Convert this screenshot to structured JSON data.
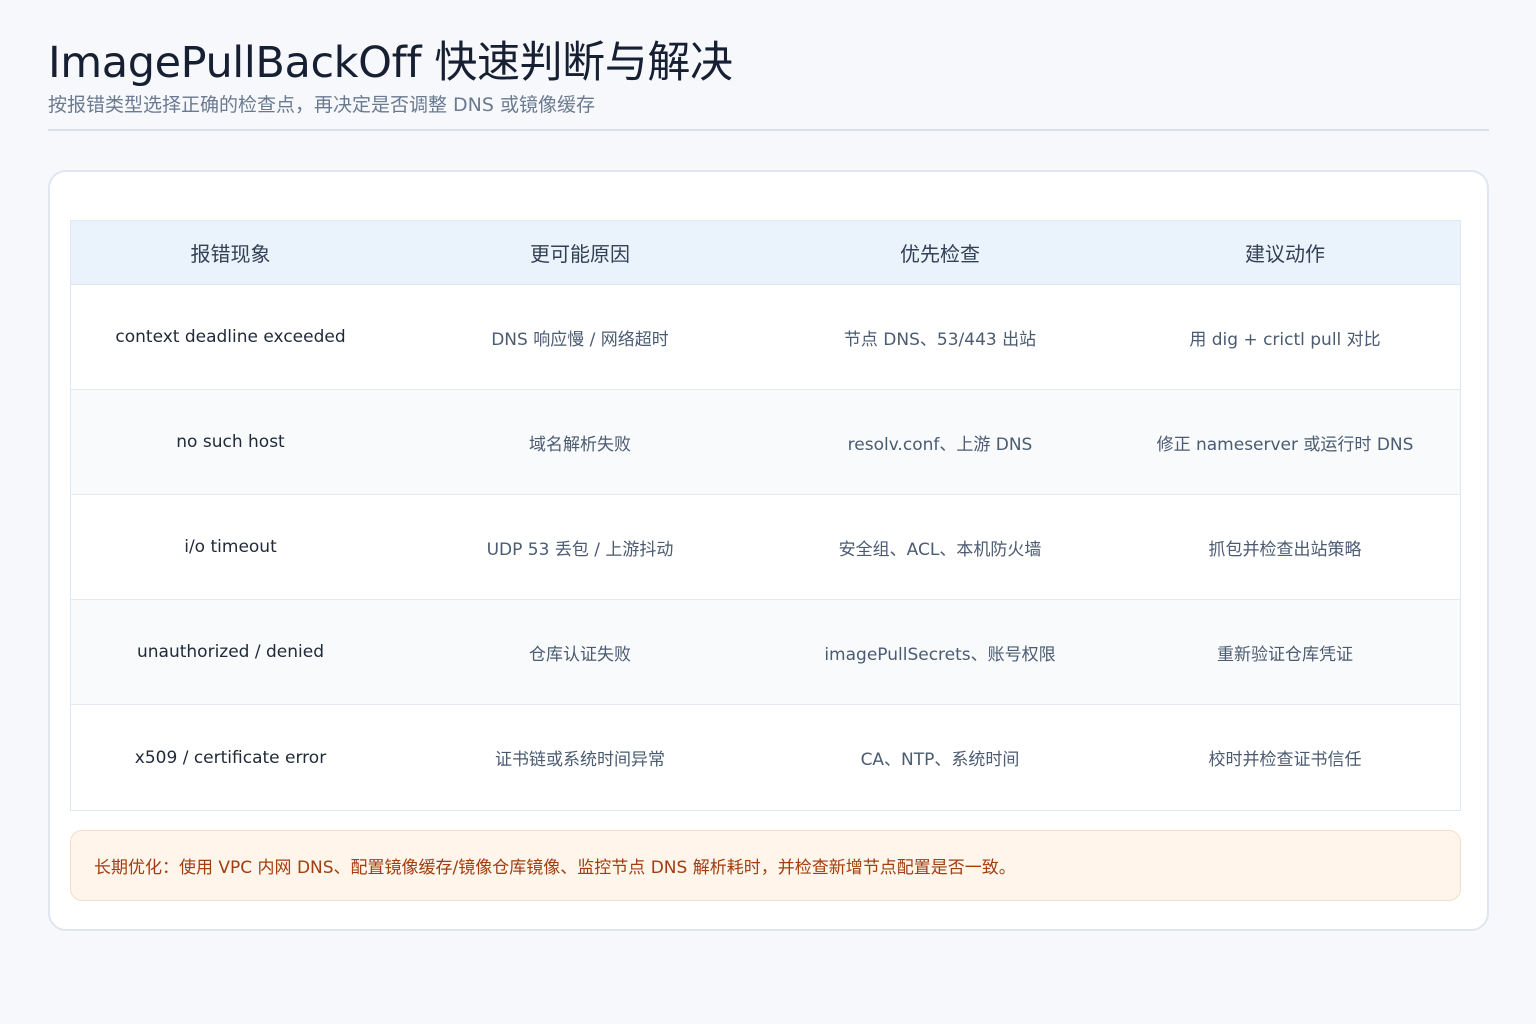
{
  "header": {
    "title": "ImagePullBackOff 快速判断与解决",
    "subtitle": "按报错类型选择正确的检查点，再决定是否调整 DNS 或镜像缓存"
  },
  "table": {
    "columns": [
      "报错现象",
      "更可能原因",
      "优先检查",
      "建议动作"
    ],
    "rows": [
      {
        "symptom": "context deadline exceeded",
        "cause": "DNS 响应慢 / 网络超时",
        "check": "节点 DNS、53/443 出站",
        "action": "用 dig + crictl pull 对比"
      },
      {
        "symptom": "no such host",
        "cause": "域名解析失败",
        "check": "resolv.conf、上游 DNS",
        "action": "修正 nameserver 或运行时 DNS"
      },
      {
        "symptom": "i/o timeout",
        "cause": "UDP 53 丢包 / 上游抖动",
        "check": "安全组、ACL、本机防火墙",
        "action": "抓包并检查出站策略"
      },
      {
        "symptom": "unauthorized / denied",
        "cause": "仓库认证失败",
        "check": "imagePullSecrets、账号权限",
        "action": "重新验证仓库凭证"
      },
      {
        "symptom": "x509 / certificate error",
        "cause": "证书链或系统时间异常",
        "check": "CA、NTP、系统时间",
        "action": "校时并检查证书信任"
      }
    ]
  },
  "note": {
    "text": "长期优化：使用 VPC 内网 DNS、配置镜像缓存/镜像仓库镜像、监控节点 DNS 解析耗时，并检查新增节点配置是否一致。"
  },
  "colors": {
    "background": "#f6f8fb",
    "header_row": "#eaf2fb",
    "note_background": "#fff5ea",
    "note_text": "#a13d0f"
  }
}
